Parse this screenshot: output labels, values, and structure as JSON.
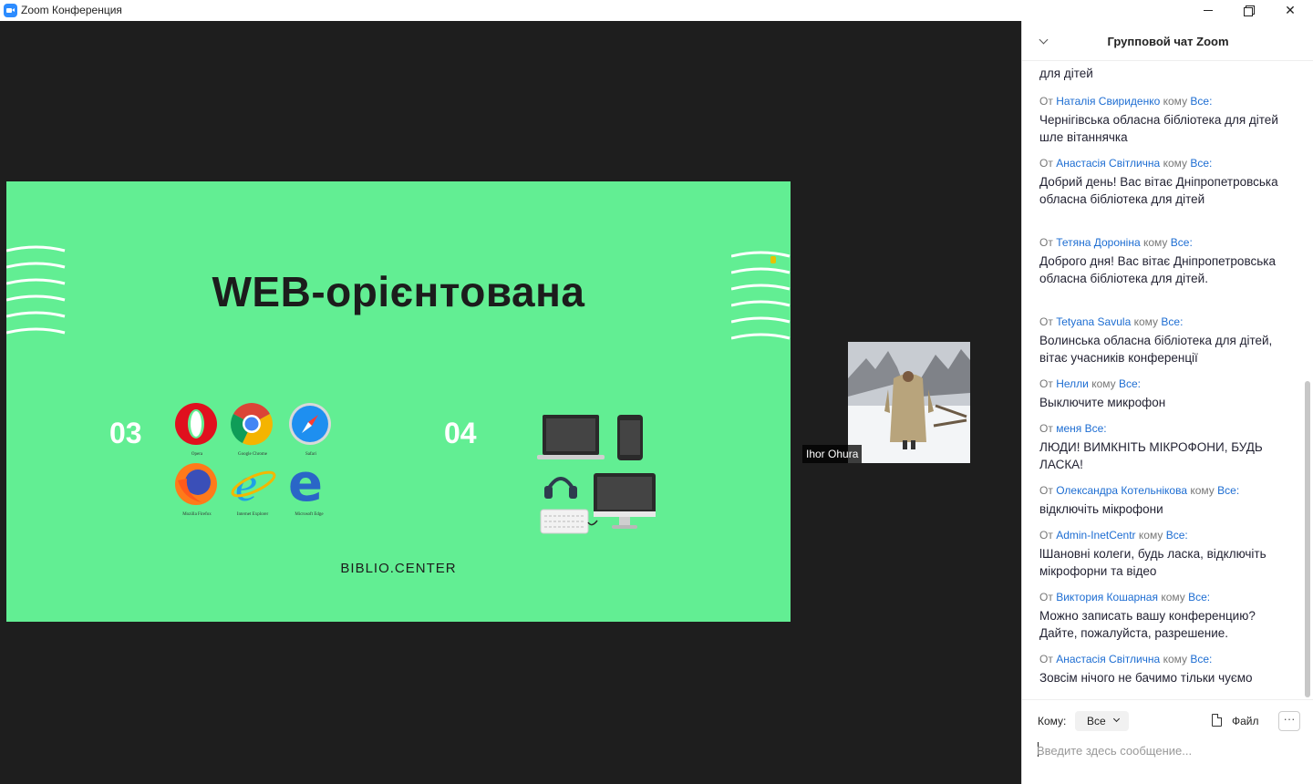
{
  "window": {
    "title": "Zoom Конференция"
  },
  "slide": {
    "title": "WEB-орієнтована",
    "number_left": "03",
    "number_right": "04",
    "footer": "BIBLIO.CENTER",
    "background_color": "#62ee93",
    "browsers": [
      {
        "label": "Opera"
      },
      {
        "label": "Google Chrome"
      },
      {
        "label": "Safari"
      },
      {
        "label": "Mozilla Firefox"
      },
      {
        "label": "Internet Explorer"
      },
      {
        "label": "Microsoft Edge"
      }
    ],
    "devices": [
      "laptop-icon",
      "smartphone-icon",
      "headphones-icon",
      "monitor-icon",
      "keyboard-icon"
    ]
  },
  "participant": {
    "name": "Ihor Ohura"
  },
  "chat": {
    "title": "Групповой чат Zoom",
    "first_line": "для дітей",
    "from_word": "От",
    "to_word": "кому",
    "messages": [
      {
        "from": "Наталія Свириденко",
        "to": "Все:",
        "text": "Чернігівська обласна бібліотека для дітей шле вітаннячка"
      },
      {
        "from": "Анастасія Світлична",
        "to": "Все:",
        "text": "Добрий день! Вас вітає Дніпропетровська обласна бібліотека для дітей"
      },
      {
        "from": "Тетяна Дороніна",
        "to": "Все:",
        "text": "Доброго дня! Вас вітає Дніпропетровська обласна бібліотека для дітей."
      },
      {
        "from": "Tetyana Savula",
        "to": "Все:",
        "text": "Волинська обласна бібліотека для дітей, вітає учасників конференції"
      },
      {
        "from": "Нелли",
        "to": "Все:",
        "text": "Выключите микрофон"
      },
      {
        "from": "меня",
        "to": "Все:",
        "text": "ЛЮДИ! ВИМКНІТЬ МІКРОФОНИ, БУДЬ ЛАСКА!",
        "self": true
      },
      {
        "from": "Олександра Котельнікова",
        "to": "Все:",
        "text": "відключіть мікрофони"
      },
      {
        "from": "Admin-InetCentr",
        "to": "Все:",
        "text": "lШановні колеги, будь ласка, відключіть мікрофорни та відео"
      },
      {
        "from": "Виктория Кошарная",
        "to": "Все:",
        "text": "Можно записать вашу конференцию? Дайте, пожалуйста, разрешение."
      },
      {
        "from": "Анастасія Світлична",
        "to": "Все:",
        "text": "Зовсім нічого не бачимо тільки чуємо"
      }
    ],
    "compose": {
      "to_label": "Кому:",
      "to_value": "Все",
      "file_label": "Файл",
      "more_label": "···",
      "placeholder": "Введите здесь сообщение..."
    },
    "colors": {
      "name": "#1d6dd2",
      "meta": "#777777"
    }
  }
}
